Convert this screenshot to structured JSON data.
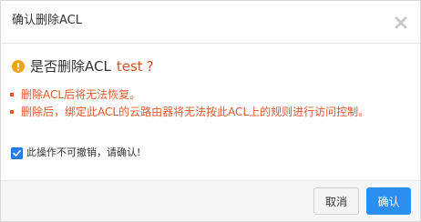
{
  "dialog": {
    "title": "确认删除ACL",
    "question_prefix": "是否删除ACL",
    "target_name": "test",
    "question_mark": "?",
    "notes": [
      "删除ACL后将无法恢复。",
      "删除后，绑定此ACL的云路由器将无法按此ACL上的规则进行访问控制。"
    ],
    "confirm_checkbox": {
      "checked": true,
      "label": "此操作不可撤销，请确认!"
    },
    "buttons": {
      "cancel_label": "取消",
      "ok_label": "确认"
    }
  },
  "icons": {
    "close": "close-icon",
    "warning": "warning-icon",
    "check": "check-icon"
  },
  "colors": {
    "warning_icon": "#f2a318",
    "accent_orange": "#e2572c",
    "primary_blue": "#2b8ff0",
    "title_text": "#333333"
  }
}
